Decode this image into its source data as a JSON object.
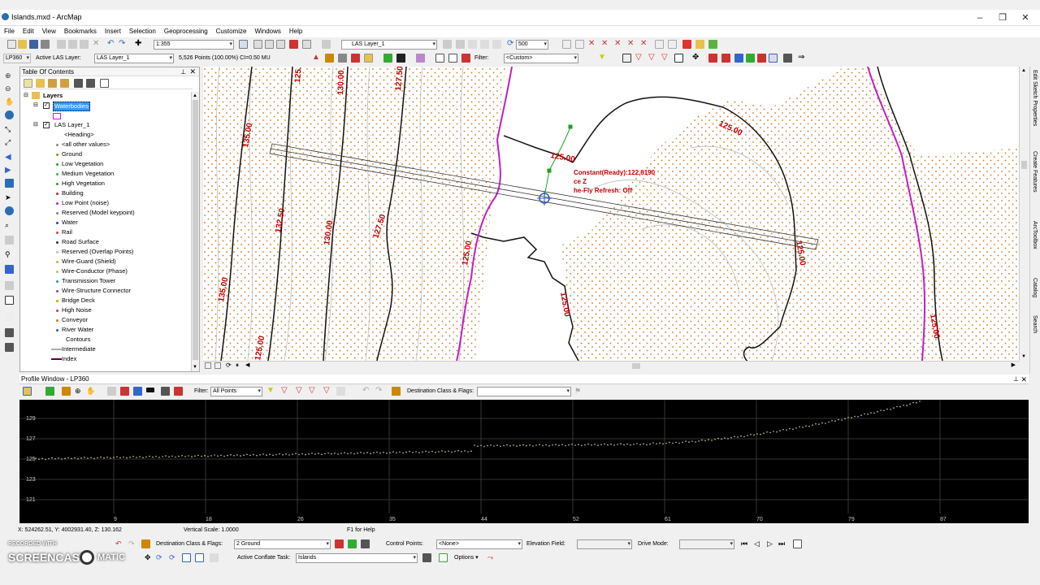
{
  "window": {
    "title": "Islands.mxd - ArcMap",
    "minimize": "–",
    "maximize": "❐",
    "close": "✕"
  },
  "menu": [
    "File",
    "Edit",
    "View",
    "Bookmarks",
    "Insert",
    "Selection",
    "Geoprocessing",
    "Customize",
    "Windows",
    "Help"
  ],
  "toolbar1": {
    "scale": "1:355",
    "las_layer": "LAS Layer_1",
    "value_500": "500"
  },
  "toolbar2": {
    "lp360": "LP360",
    "active_las_label": "Active LAS Layer:",
    "active_las": "LAS Layer_1",
    "points_info": "5,526 Points (100.00%) CI=0.50 MU",
    "filter_label": "Filter:",
    "filter_value": "<Custom>"
  },
  "toc": {
    "title": "Table Of Contents",
    "layers_label": "Layers",
    "waterbodies": "Waterbodies",
    "las_layer": "LAS Layer_1",
    "heading": "<Heading>",
    "classes": [
      {
        "label": "<all other values>",
        "color": "#888888"
      },
      {
        "label": "Ground",
        "color": "#c87820"
      },
      {
        "label": "Low Vegetation",
        "color": "#30a030"
      },
      {
        "label": "Medium Vegetation",
        "color": "#40b040"
      },
      {
        "label": "High Vegetation",
        "color": "#20a020"
      },
      {
        "label": "Building",
        "color": "#d02020"
      },
      {
        "label": "Low Point (noise)",
        "color": "#c020c0"
      },
      {
        "label": "Reserved (Model keypoint)",
        "color": "#808080"
      },
      {
        "label": "Water",
        "color": "#2040d0"
      },
      {
        "label": "Rail",
        "color": "#e04040"
      },
      {
        "label": "Road Surface",
        "color": "#303030"
      },
      {
        "label": "Reserved (Overlap Points)",
        "color": "#c0c0c0"
      },
      {
        "label": "Wire-Guard (Shield)",
        "color": "#e0a040"
      },
      {
        "label": "Wire-Conductor (Phase)",
        "color": "#c0c040"
      },
      {
        "label": "Transmission Tower",
        "color": "#20a0a0"
      },
      {
        "label": "Wire-Structure Connector",
        "color": "#a040a0"
      },
      {
        "label": "Bridge Deck",
        "color": "#d0a000"
      },
      {
        "label": "High Noise",
        "color": "#e02080"
      },
      {
        "label": "Conveyor",
        "color": "#e07020"
      },
      {
        "label": "River Water",
        "color": "#2060c0"
      }
    ],
    "contours": "Contours",
    "intermediate": "Intermediate",
    "index": "Index"
  },
  "map": {
    "contour_labels": [
      "125.00",
      "135.00",
      "130.00",
      "127.50",
      "132.50",
      "130.00",
      "127.50",
      "125.00",
      "135.00",
      "125.00",
      "125.00",
      "125.00",
      "125.00",
      "125.00",
      "125.00"
    ],
    "overlay": [
      "Constant(Ready):122.6190",
      "ce Z",
      "he-Fly Refresh: Off"
    ]
  },
  "profile": {
    "title": "Profile Window - LP360",
    "filter_label": "Filter:",
    "filter_value": "All Points",
    "dest_label": "Destination Class & Flags:",
    "y_ticks": [
      "129",
      "127",
      "125",
      "123",
      "121"
    ],
    "x_ticks": [
      "9",
      "18",
      "26",
      "35",
      "44",
      "52",
      "61",
      "70",
      "79",
      "87"
    ]
  },
  "status": {
    "coords": "X: 524262.51, Y: 4002931.40, Z: 130.162",
    "vscale": "Vertical Scale: 1.0000",
    "help": "F1 for Help"
  },
  "bottom1": {
    "dest_label": "Destination Class & Flags:",
    "dest_value": "2  Ground",
    "control_label": "Control Points:",
    "control_value": "<None>",
    "elev_label": "Elevation Field:",
    "drive_label": "Drive Mode:"
  },
  "bottom2": {
    "conflate_label": "Active Conflate Task:",
    "conflate_value": "Islands",
    "options": "Options ▾"
  },
  "watermark": {
    "line1": "RECORDED WITH",
    "line2": "SCREENCAST",
    "line3": "MATIC"
  },
  "right_panels": [
    "Edit Sketch Properties",
    "Create Features",
    "ArcToolbox",
    "Catalog",
    "Search"
  ]
}
